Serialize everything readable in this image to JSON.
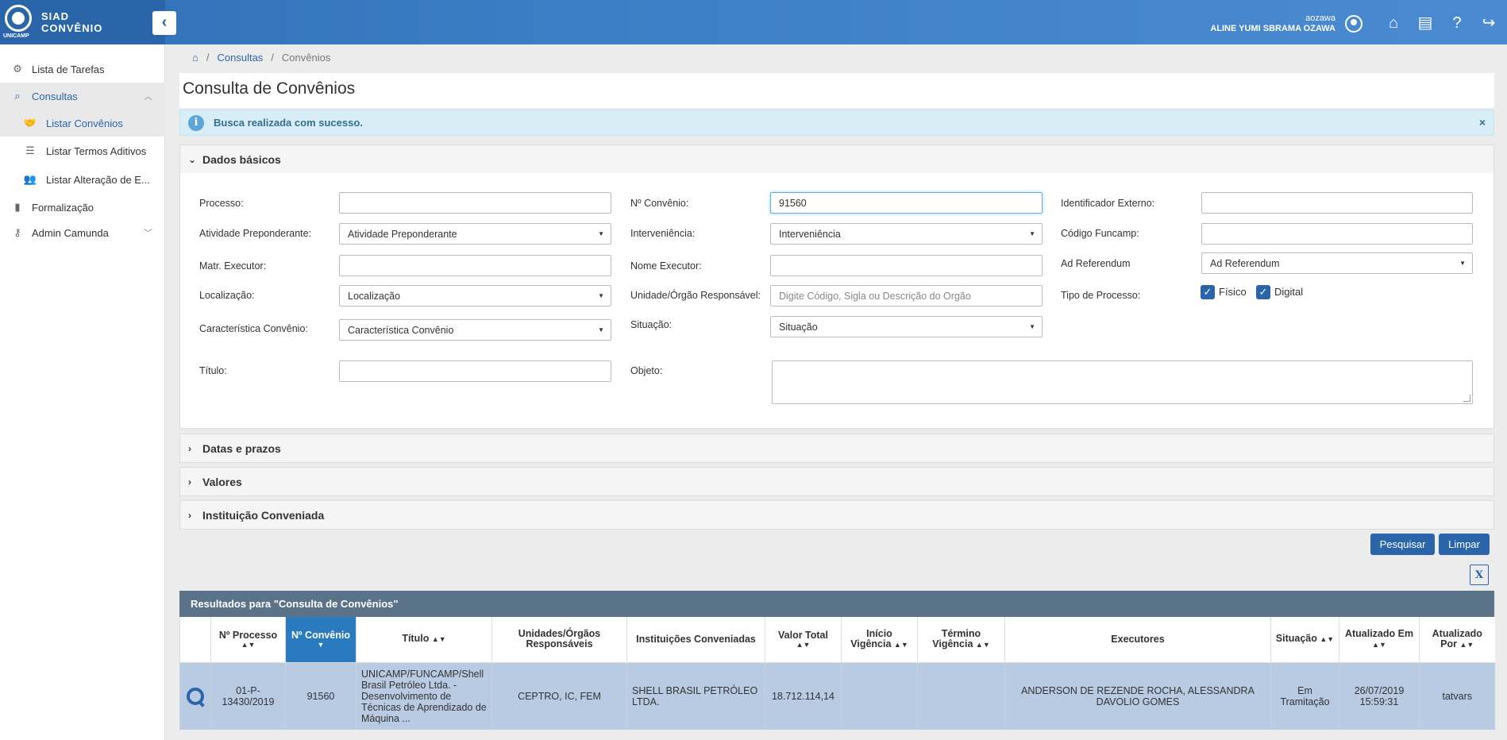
{
  "header": {
    "brand_top": "SIAD",
    "brand_bottom": "CONVÊNIO",
    "brand_small": "UNICAMP",
    "username": "aozawa",
    "fullname": "ALINE YUMI SBRAMA OZAWA"
  },
  "sidebar": {
    "items": [
      {
        "label": "Lista de Tarefas",
        "icon": "gear-icon"
      },
      {
        "label": "Consultas",
        "icon": "search-icon"
      },
      {
        "label": "Listar Convênios",
        "icon": "handshake-icon"
      },
      {
        "label": "Listar Termos Aditivos",
        "icon": "list-indent-icon"
      },
      {
        "label": "Listar Alteração de E...",
        "icon": "users-icon"
      },
      {
        "label": "Formalização",
        "icon": "book-icon"
      },
      {
        "label": "Admin Camunda",
        "icon": "key-icon"
      }
    ]
  },
  "breadcrumb": {
    "items": [
      "Consultas",
      "Convênios"
    ]
  },
  "page": {
    "title": "Consulta de Convênios"
  },
  "alert": {
    "text": "Busca realizada com sucesso.",
    "close": "×"
  },
  "panels": {
    "dados_basicos": "Dados básicos",
    "datas": "Datas e prazos",
    "valores": "Valores",
    "instituicao": "Instituição Conveniada"
  },
  "form": {
    "processo": {
      "label": "Processo:",
      "value": ""
    },
    "n_convenio": {
      "label": "Nº Convênio:",
      "value": "91560"
    },
    "identificador": {
      "label": "Identificador Externo:",
      "value": ""
    },
    "atividade": {
      "label": "Atividade Preponderante:",
      "value": "Atividade Preponderante"
    },
    "interveniencia": {
      "label": "Interveniência:",
      "value": "Interveniência"
    },
    "codigo_funcamp": {
      "label": "Código Funcamp:",
      "value": ""
    },
    "matr_executor": {
      "label": "Matr. Executor:",
      "value": ""
    },
    "nome_executor": {
      "label": "Nome Executor:",
      "value": ""
    },
    "ad_referendum": {
      "label": "Ad Referendum",
      "value": "Ad Referendum"
    },
    "localizacao": {
      "label": "Localização:",
      "value": "Localização"
    },
    "unidade": {
      "label": "Unidade/Órgão Responsável:",
      "placeholder": "Digite Código, Sigla ou Descrição do Orgão"
    },
    "tipo_processo": {
      "label": "Tipo de Processo:",
      "fisico": "Físico",
      "digital": "Digital"
    },
    "caracteristica": {
      "label": "Característica Convênio:",
      "value": "Característica Convênio"
    },
    "situacao": {
      "label": "Situação:",
      "value": "Situação"
    },
    "titulo": {
      "label": "Título:",
      "value": ""
    },
    "objeto": {
      "label": "Objeto:",
      "value": ""
    }
  },
  "buttons": {
    "pesquisar": "Pesquisar",
    "limpar": "Limpar",
    "excel": "X"
  },
  "results": {
    "title": "Resultados para \"Consulta de Convênios\"",
    "columns": [
      "Nº Processo",
      "Nº Convênio",
      "Título",
      "Unidades/Órgãos Responsáveis",
      "Instituições Conveniadas",
      "Valor Total",
      "Início Vigência",
      "Término Vigência",
      "Executores",
      "Situação",
      "Atualizado Em",
      "Atualizado Por"
    ],
    "rows": [
      {
        "processo": "01-P-13430/2019",
        "convenio": "91560",
        "titulo": "UNICAMP/FUNCAMP/Shell Brasil Petróleo Ltda. - Desenvolvimento de Técnicas de Aprendizado de Máquina ...",
        "unidades": "CEPTRO, IC, FEM",
        "instituicoes": "SHELL BRASIL PETRÓLEO LTDA.",
        "valor": "18.712.114,14",
        "inicio": "",
        "termino": "",
        "executores": "ANDERSON DE REZENDE ROCHA, ALESSANDRA DAVOLIO GOMES",
        "situacao": "Em Tramitação",
        "atualizado_em": "26/07/2019 15:59:31",
        "atualizado_por": "tatvars"
      }
    ]
  }
}
